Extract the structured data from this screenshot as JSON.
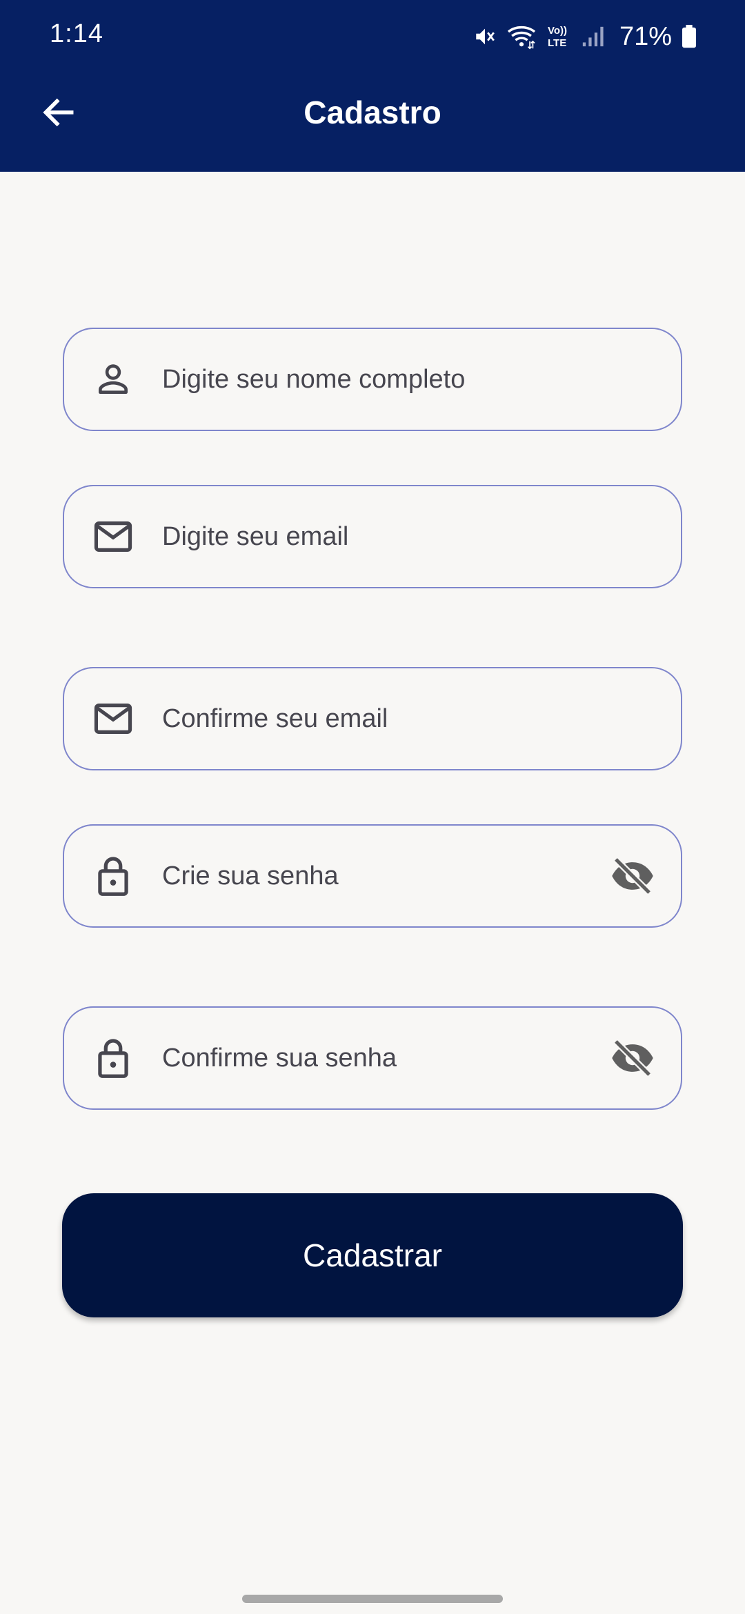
{
  "status_bar": {
    "time": "1:14",
    "battery": "71%",
    "icons": [
      "mute-icon",
      "wifi-icon",
      "volte-icon",
      "signal-icon",
      "battery-icon"
    ],
    "volte_label": "Vo)) LTE"
  },
  "header": {
    "title": "Cadastro",
    "back_icon": "arrow-left-icon"
  },
  "form": {
    "full_name": {
      "placeholder": "Digite seu nome completo",
      "icon": "person-icon"
    },
    "email": {
      "placeholder": "Digite seu email",
      "icon": "mail-icon"
    },
    "confirm_email": {
      "placeholder": "Confirme seu email",
      "icon": "mail-icon"
    },
    "password": {
      "placeholder": "Crie sua senha",
      "icon": "lock-icon",
      "toggle_icon": "eye-off-icon"
    },
    "confirm_password": {
      "placeholder": "Confirme sua senha",
      "icon": "lock-icon",
      "toggle_icon": "eye-off-icon"
    },
    "submit_label": "Cadastrar"
  },
  "colors": {
    "header_bg": "#062063",
    "page_bg": "#f8f7f5",
    "field_border": "#7f86cc",
    "button_bg": "#011440"
  }
}
